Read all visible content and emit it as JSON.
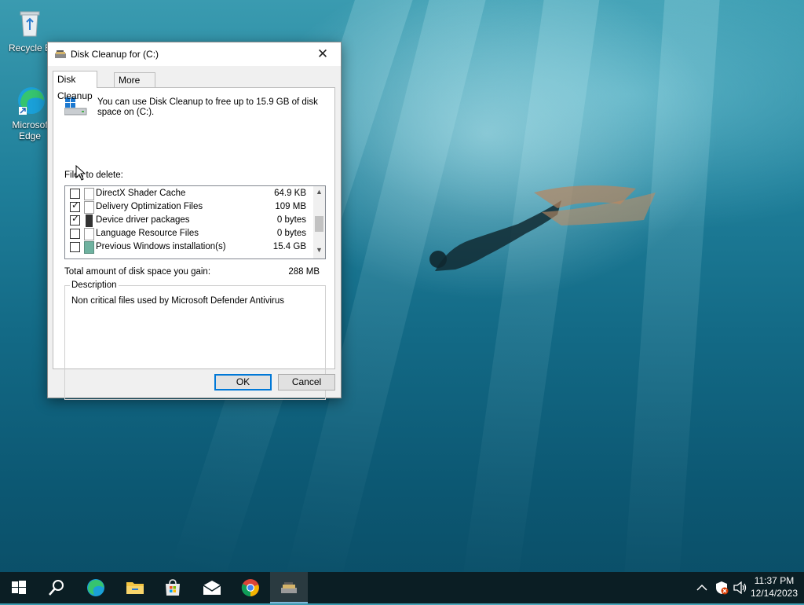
{
  "desktop": {
    "icons": [
      {
        "label": "Recycle B"
      },
      {
        "label": "Microsof"
      },
      {
        "label": "Edge"
      }
    ]
  },
  "window": {
    "title": "Disk Cleanup for  (C:)",
    "close_glyph": "✕",
    "tabs": [
      {
        "label": "Disk Cleanup",
        "active": true
      },
      {
        "label": "More Options",
        "active": false
      }
    ],
    "intro_text": "You can use Disk Cleanup to free up to 15.9 GB of disk space on  (C:).",
    "files_label": "Files to delete:",
    "files": [
      {
        "name": "DirectX Shader Cache",
        "size": "64.9 KB",
        "checked": false
      },
      {
        "name": "Delivery Optimization Files",
        "size": "109 MB",
        "checked": true
      },
      {
        "name": "Device driver packages",
        "size": "0 bytes",
        "checked": true
      },
      {
        "name": "Language Resource Files",
        "size": "0 bytes",
        "checked": false
      },
      {
        "name": "Previous Windows installation(s)",
        "size": "15.4 GB",
        "checked": false
      }
    ],
    "total_label": "Total amount of disk space you gain:",
    "total_value": "288 MB",
    "description_legend": "Description",
    "description_text": "Non critical files used by Microsoft Defender Antivirus",
    "ok_label": "OK",
    "cancel_label": "Cancel"
  },
  "taskbar": {
    "items": [
      "start",
      "search",
      "edge",
      "file-explorer",
      "microsoft-store",
      "mail",
      "chrome",
      "disk-cleanup"
    ],
    "active_item": "disk-cleanup",
    "time": "11:37 PM",
    "date": "12/14/2023"
  },
  "colors": {
    "accent": "#0078d7",
    "taskbar": "#0b1e24"
  }
}
